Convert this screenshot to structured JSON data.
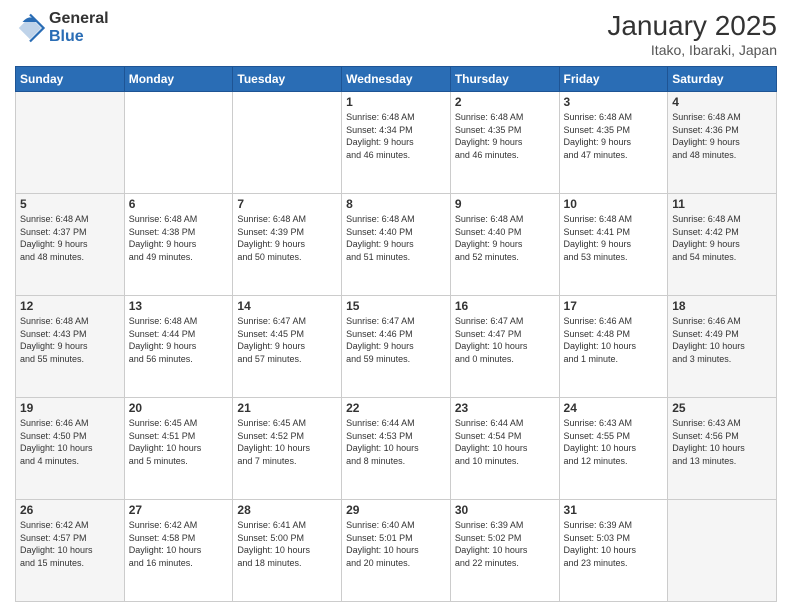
{
  "header": {
    "logo_general": "General",
    "logo_blue": "Blue",
    "month_title": "January 2025",
    "location": "Itako, Ibaraki, Japan"
  },
  "weekdays": [
    "Sunday",
    "Monday",
    "Tuesday",
    "Wednesday",
    "Thursday",
    "Friday",
    "Saturday"
  ],
  "weeks": [
    [
      {
        "day": "",
        "info": ""
      },
      {
        "day": "",
        "info": ""
      },
      {
        "day": "",
        "info": ""
      },
      {
        "day": "1",
        "info": "Sunrise: 6:48 AM\nSunset: 4:34 PM\nDaylight: 9 hours\nand 46 minutes."
      },
      {
        "day": "2",
        "info": "Sunrise: 6:48 AM\nSunset: 4:35 PM\nDaylight: 9 hours\nand 46 minutes."
      },
      {
        "day": "3",
        "info": "Sunrise: 6:48 AM\nSunset: 4:35 PM\nDaylight: 9 hours\nand 47 minutes."
      },
      {
        "day": "4",
        "info": "Sunrise: 6:48 AM\nSunset: 4:36 PM\nDaylight: 9 hours\nand 48 minutes."
      }
    ],
    [
      {
        "day": "5",
        "info": "Sunrise: 6:48 AM\nSunset: 4:37 PM\nDaylight: 9 hours\nand 48 minutes."
      },
      {
        "day": "6",
        "info": "Sunrise: 6:48 AM\nSunset: 4:38 PM\nDaylight: 9 hours\nand 49 minutes."
      },
      {
        "day": "7",
        "info": "Sunrise: 6:48 AM\nSunset: 4:39 PM\nDaylight: 9 hours\nand 50 minutes."
      },
      {
        "day": "8",
        "info": "Sunrise: 6:48 AM\nSunset: 4:40 PM\nDaylight: 9 hours\nand 51 minutes."
      },
      {
        "day": "9",
        "info": "Sunrise: 6:48 AM\nSunset: 4:40 PM\nDaylight: 9 hours\nand 52 minutes."
      },
      {
        "day": "10",
        "info": "Sunrise: 6:48 AM\nSunset: 4:41 PM\nDaylight: 9 hours\nand 53 minutes."
      },
      {
        "day": "11",
        "info": "Sunrise: 6:48 AM\nSunset: 4:42 PM\nDaylight: 9 hours\nand 54 minutes."
      }
    ],
    [
      {
        "day": "12",
        "info": "Sunrise: 6:48 AM\nSunset: 4:43 PM\nDaylight: 9 hours\nand 55 minutes."
      },
      {
        "day": "13",
        "info": "Sunrise: 6:48 AM\nSunset: 4:44 PM\nDaylight: 9 hours\nand 56 minutes."
      },
      {
        "day": "14",
        "info": "Sunrise: 6:47 AM\nSunset: 4:45 PM\nDaylight: 9 hours\nand 57 minutes."
      },
      {
        "day": "15",
        "info": "Sunrise: 6:47 AM\nSunset: 4:46 PM\nDaylight: 9 hours\nand 59 minutes."
      },
      {
        "day": "16",
        "info": "Sunrise: 6:47 AM\nSunset: 4:47 PM\nDaylight: 10 hours\nand 0 minutes."
      },
      {
        "day": "17",
        "info": "Sunrise: 6:46 AM\nSunset: 4:48 PM\nDaylight: 10 hours\nand 1 minute."
      },
      {
        "day": "18",
        "info": "Sunrise: 6:46 AM\nSunset: 4:49 PM\nDaylight: 10 hours\nand 3 minutes."
      }
    ],
    [
      {
        "day": "19",
        "info": "Sunrise: 6:46 AM\nSunset: 4:50 PM\nDaylight: 10 hours\nand 4 minutes."
      },
      {
        "day": "20",
        "info": "Sunrise: 6:45 AM\nSunset: 4:51 PM\nDaylight: 10 hours\nand 5 minutes."
      },
      {
        "day": "21",
        "info": "Sunrise: 6:45 AM\nSunset: 4:52 PM\nDaylight: 10 hours\nand 7 minutes."
      },
      {
        "day": "22",
        "info": "Sunrise: 6:44 AM\nSunset: 4:53 PM\nDaylight: 10 hours\nand 8 minutes."
      },
      {
        "day": "23",
        "info": "Sunrise: 6:44 AM\nSunset: 4:54 PM\nDaylight: 10 hours\nand 10 minutes."
      },
      {
        "day": "24",
        "info": "Sunrise: 6:43 AM\nSunset: 4:55 PM\nDaylight: 10 hours\nand 12 minutes."
      },
      {
        "day": "25",
        "info": "Sunrise: 6:43 AM\nSunset: 4:56 PM\nDaylight: 10 hours\nand 13 minutes."
      }
    ],
    [
      {
        "day": "26",
        "info": "Sunrise: 6:42 AM\nSunset: 4:57 PM\nDaylight: 10 hours\nand 15 minutes."
      },
      {
        "day": "27",
        "info": "Sunrise: 6:42 AM\nSunset: 4:58 PM\nDaylight: 10 hours\nand 16 minutes."
      },
      {
        "day": "28",
        "info": "Sunrise: 6:41 AM\nSunset: 5:00 PM\nDaylight: 10 hours\nand 18 minutes."
      },
      {
        "day": "29",
        "info": "Sunrise: 6:40 AM\nSunset: 5:01 PM\nDaylight: 10 hours\nand 20 minutes."
      },
      {
        "day": "30",
        "info": "Sunrise: 6:39 AM\nSunset: 5:02 PM\nDaylight: 10 hours\nand 22 minutes."
      },
      {
        "day": "31",
        "info": "Sunrise: 6:39 AM\nSunset: 5:03 PM\nDaylight: 10 hours\nand 23 minutes."
      },
      {
        "day": "",
        "info": ""
      }
    ]
  ]
}
